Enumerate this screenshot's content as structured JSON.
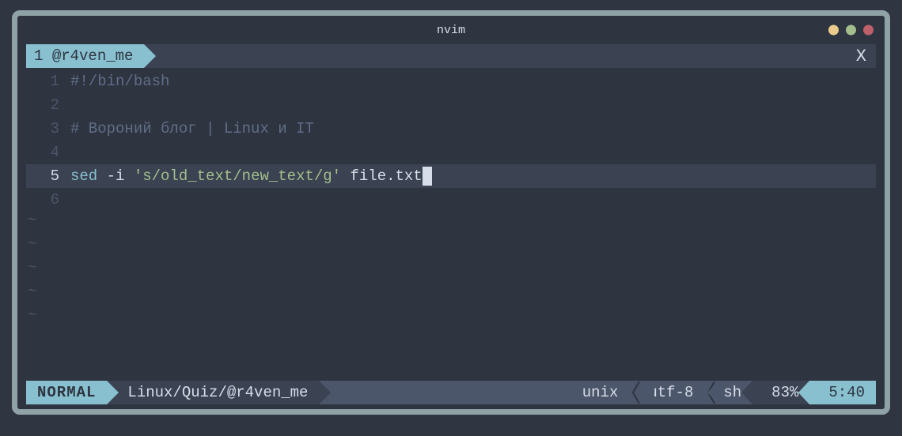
{
  "window": {
    "title": "nvim"
  },
  "tabline": {
    "tab_number": "1",
    "tab_label": "@r4ven_me",
    "close_glyph": "X"
  },
  "lines": [
    {
      "n": "1",
      "tokens": [
        {
          "t": "#!/bin/bash",
          "c": "tok-comment"
        }
      ]
    },
    {
      "n": "2",
      "tokens": []
    },
    {
      "n": "3",
      "tokens": [
        {
          "t": "# Вороний блог | Linux и IT",
          "c": "tok-comment"
        }
      ]
    },
    {
      "n": "4",
      "tokens": []
    },
    {
      "n": "5",
      "current": true,
      "tokens": [
        {
          "t": "sed",
          "c": "tok-cmd"
        },
        {
          "t": " ",
          "c": "tok-plain"
        },
        {
          "t": "-i",
          "c": "tok-flag"
        },
        {
          "t": " ",
          "c": "tok-plain"
        },
        {
          "t": "'s/old_text/new_text/g'",
          "c": "tok-string"
        },
        {
          "t": " file.txt",
          "c": "tok-plain"
        }
      ],
      "cursor_after": true
    },
    {
      "n": "6",
      "tokens": []
    }
  ],
  "tilde_count": 5,
  "statusline": {
    "mode": "NORMAL",
    "path": "Linux/Quiz/@r4ven_me",
    "fileformat": "unix",
    "encoding": "utf-8",
    "filetype": "sh",
    "percent": "83%",
    "position": "5:40"
  },
  "colors": {
    "accent": "#88c0d0",
    "bg": "#2e3440",
    "bg_alt": "#3b4252",
    "bg_alt2": "#4c566a",
    "fg": "#d8dee9",
    "comment": "#616e88",
    "string": "#a3be8c",
    "border": "#8fa2a6"
  }
}
